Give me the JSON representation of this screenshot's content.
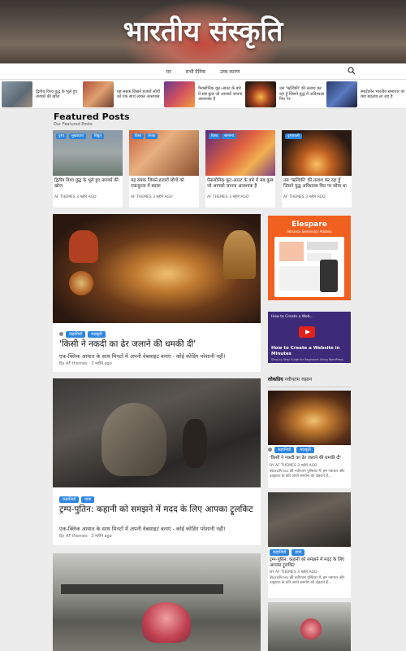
{
  "header": {
    "site_title": "भारतीय संस्कृति"
  },
  "nav": {
    "items": [
      "घर",
      "सभी दैनिक",
      "उच्च कारण"
    ]
  },
  "ticker": [
    {
      "title": "द्वितीय विश्व युद्ध के भूले हुए नायकों की खोज"
    },
    {
      "title": "यह सबक जिसने हजारों लोगों को एक साथ लाकर आसपास"
    },
    {
      "title": "पैनासोनिक कूट-आउट के बारे में सब कुछ जो आपको जानना आवश्यक है"
    },
    {
      "title": "उस 'ऋत्विकी' की तलाश कर रहा हूँ जिसने युद्ध में अविश्वास फिर पर"
    },
    {
      "title": "स्मार्टफ़ोन भारतीय समाचार पर क्या बदलाव ला रहा है"
    }
  ],
  "featured": {
    "heading": "Featured Posts",
    "subheading": "Our Featured Posts",
    "cards": [
      {
        "tags": [
          "दृश्य",
          "मुख्यधारा",
          "विद्युत"
        ],
        "title": "द्वितीय विश्व युद्ध के भूले हुए नायकों की खोज",
        "author": "AF THEMES",
        "time": "3 महीने AGO"
      },
      {
        "tags": [
          "विश्व",
          "रोचक"
        ],
        "title": "यह सबक जिसने हजारों लोगों को एकजुटता में बदला",
        "author": "AF THEMES",
        "time": "3 महीने AGO"
      },
      {
        "tags": [
          "विश्व",
          "सामान्य"
        ],
        "title": "पैनासोनिक फूट-आउट के बारे में सब कुछ जो आपको जानना आवश्यक है",
        "author": "AF THEMES",
        "time": "3 महीने AGO"
      },
      {
        "tags": [
          "दृश्यावली"
        ],
        "title": "उस 'ऋत्विकी' की तलाश कर रहा हूँ जिसने युद्ध अविश्वास फिर पर सोचा था",
        "author": "AF THEMES",
        "time": "3 महीने AGO"
      }
    ]
  },
  "posts": [
    {
      "tags": [
        "कहानियाँ",
        "मज़बूती"
      ],
      "title": "'किसी ने नकदी का ढेर जलाने की धमकी दी'",
      "excerpt": "एक-क्लिक आयात के साथ मिनटों में अपनी वेबसाइट बनाएं - कोई कोडिंग परेशानी नहीं!",
      "author": "By AF themes",
      "time": "3 महीने ago"
    },
    {
      "tags": [
        "कहानियाँ",
        "यात्रा"
      ],
      "title": "ट्रम्प-पुतिन: कहानी को समझने में मदद के लिए आपका ट्रूलकिट",
      "excerpt": "एक-क्लिक आयात के साथ मिनटों में अपनी वेबसाइट बनाएं - कोई कोडिंग परेशानी नहीं!",
      "author": "By AF themes",
      "time": "3 महीने ago"
    }
  ],
  "ads": {
    "elespare_brand": "Elespare",
    "elespare_sub": "Advance Elementor Addons",
    "video_header": "How to Create a Web...",
    "video_title": "How to Create a Website in Minutes",
    "video_sub": "Step-by-Step Guide for Beginners Using WordPress"
  },
  "sidebar": {
    "tab_popular": "लोकप्रिय",
    "tab_latest": "नवीनतम",
    "tab_trending": "रुझान",
    "posts": [
      {
        "tags": [
          "कहानियाँ",
          "मज़बूती"
        ],
        "title": "'किसी ने नकदी का ढेर जलाने की धमकी दी'",
        "meta": "BY AF THEMES 3 महीने AGO",
        "excerpt": "WordPress की नवीनतम पुस्तिका में, हम नवाचार और उत्कृष्टता के प्रति अपने समर्पण को दोहराते हैं..."
      },
      {
        "tags": [
          "कहानियाँ",
          "यात्रा"
        ],
        "title": "ट्रम्प-पुतिन: कहानी को समझने में मदद के लिए आपका ट्रूलकिट",
        "meta": "BY AF THEMES 3 महीने AGO",
        "excerpt": "WordPress की नवीनतम पुस्तिका में, हम नवाचार और उत्कृष्टता के प्रति अपने समर्पण को दोहराते हैं..."
      }
    ]
  }
}
